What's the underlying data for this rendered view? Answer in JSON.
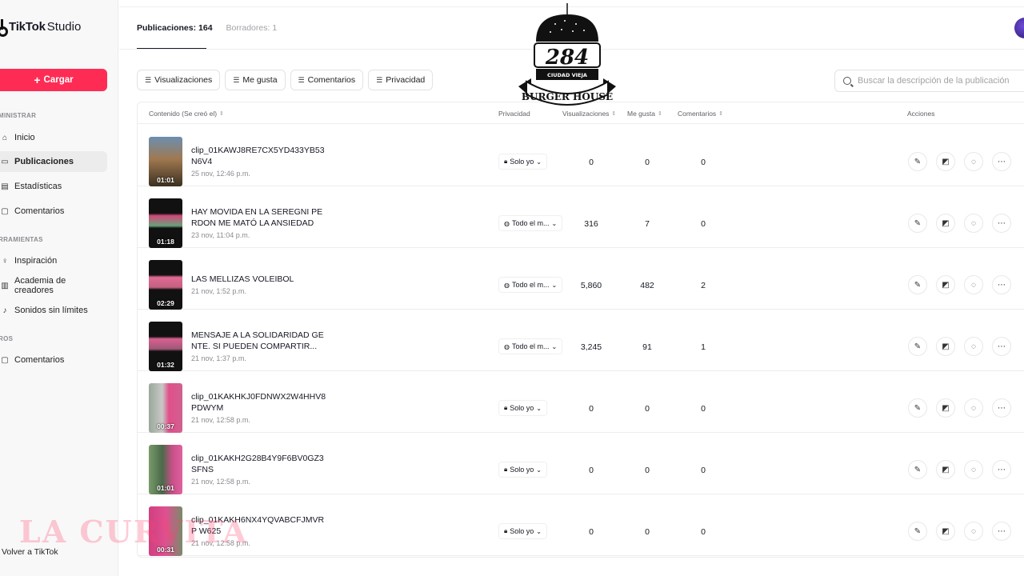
{
  "brand": {
    "name_bold": "TikTok",
    "name_light": "Studio"
  },
  "sidebar": {
    "upload_label": "Cargar",
    "sections": [
      {
        "label": "MINISTRAR"
      },
      {
        "label": "RRAMIENTAS"
      },
      {
        "label": "ROS"
      }
    ],
    "items": [
      {
        "label": "Inicio",
        "icon": "home-icon"
      },
      {
        "label": "Publicaciones",
        "icon": "posts-icon",
        "active": true
      },
      {
        "label": "Estadísticas",
        "icon": "stats-icon"
      },
      {
        "label": "Comentarios",
        "icon": "comment-icon"
      },
      {
        "label": "Inspiración",
        "icon": "bulb-icon"
      },
      {
        "label": "Academia de creadores",
        "icon": "academy-icon"
      },
      {
        "label": "Sonidos sin límites",
        "icon": "music-icon"
      },
      {
        "label": "Comentarios",
        "icon": "comment-icon"
      }
    ],
    "back_label": "Volver a TikTok"
  },
  "tabs": [
    {
      "label": "Publicaciones: 164",
      "active": true
    },
    {
      "label": "Borradores: 1",
      "active": false
    }
  ],
  "filters": [
    "Visualizaciones",
    "Me gusta",
    "Comentarios",
    "Privacidad"
  ],
  "search": {
    "placeholder": "Buscar la descripción de la publicación"
  },
  "table": {
    "headers": {
      "content": "Contenido (Se creó el)",
      "privacy": "Privacidad",
      "views": "Visualizaciones",
      "likes": "Me gusta",
      "comments": "Comentarios",
      "actions": "Acciones"
    },
    "rows": [
      {
        "title": "clip_01KAWJ8RE7CX5YD433YB53 N6V4",
        "date": "25 nov, 12:46 p.m.",
        "duration": "01:01",
        "privacy": "Solo yo",
        "privacy_icon": "lock-icon",
        "views": "0",
        "likes": "0",
        "comments": "0"
      },
      {
        "title": "HAY MOVIDA EN LA SEREGNI PERDON ME MATÓ LA ANSIEDAD",
        "date": "23 nov, 11:04 p.m.",
        "duration": "01:18",
        "privacy": "Todo el m...",
        "privacy_icon": "globe-icon",
        "views": "316",
        "likes": "7",
        "comments": "0"
      },
      {
        "title": "LAS MELLIZAS VOLEIBOL",
        "date": "21 nov, 1:52 p.m.",
        "duration": "02:29",
        "privacy": "Todo el m...",
        "privacy_icon": "globe-icon",
        "views": "5,860",
        "likes": "482",
        "comments": "2"
      },
      {
        "title": "MENSAJE A LA SOLIDARIDAD GENTE. SI PUEDEN COMPARTIR...",
        "date": "21 nov, 1:37 p.m.",
        "duration": "01:32",
        "privacy": "Todo el m...",
        "privacy_icon": "globe-icon",
        "views": "3,245",
        "likes": "91",
        "comments": "1"
      },
      {
        "title": "clip_01KAKHKJ0FDNWX2W4HHV8 PDWYM",
        "date": "21 nov, 12:58 p.m.",
        "duration": "00:37",
        "privacy": "Solo yo",
        "privacy_icon": "lock-icon",
        "views": "0",
        "likes": "0",
        "comments": "0"
      },
      {
        "title": "clip_01KAKH2G28B4Y9F6BV0GZ3 SFNS",
        "date": "21 nov, 12:58 p.m.",
        "duration": "01:01",
        "privacy": "Solo yo",
        "privacy_icon": "lock-icon",
        "views": "0",
        "likes": "0",
        "comments": "0"
      },
      {
        "title": "clip_01KAKH6NX4YQVABCFJMVRP W625",
        "date": "21 nov, 12:58 p.m.",
        "duration": "00:31",
        "privacy": "Solo yo",
        "privacy_icon": "lock-icon",
        "views": "0",
        "likes": "0",
        "comments": "0"
      }
    ]
  },
  "overlay": {
    "burger_logo": {
      "number": "284",
      "line1": "CIUDAD VIEJA",
      "line2": "BURGER HOUSE"
    },
    "watermark_text": "LA CURVITA"
  },
  "colors": {
    "accent": "#fe2c55",
    "text": "#161823",
    "muted": "#8a8b91"
  }
}
